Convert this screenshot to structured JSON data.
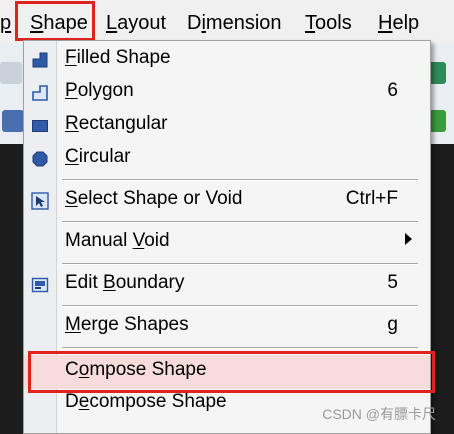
{
  "menubar": {
    "items": [
      {
        "pre": "",
        "mn": "p",
        "post": ""
      },
      {
        "pre": "",
        "mn": "S",
        "post": "hape"
      },
      {
        "pre": "",
        "mn": "L",
        "post": "ayout"
      },
      {
        "pre": "D",
        "mn": "i",
        "post": "mension"
      },
      {
        "pre": "",
        "mn": "T",
        "post": "ools"
      },
      {
        "pre": "",
        "mn": "H",
        "post": "elp"
      }
    ]
  },
  "dropdown": {
    "items": [
      {
        "pre": "",
        "mn": "F",
        "post": "illed Shape",
        "shortcut": "",
        "icon": "filled-shape-icon"
      },
      {
        "pre": "",
        "mn": "P",
        "post": "olygon",
        "shortcut": "6",
        "icon": "polygon-icon"
      },
      {
        "pre": "",
        "mn": "R",
        "post": "ectangular",
        "shortcut": "",
        "icon": "rectangle-icon"
      },
      {
        "pre": "",
        "mn": "C",
        "post": "ircular",
        "shortcut": "",
        "icon": "circle-icon"
      },
      {
        "pre": "",
        "mn": "S",
        "post": "elect Shape or Void",
        "shortcut": "Ctrl+F",
        "icon": "select-cursor-icon"
      },
      {
        "pre": "Manual ",
        "mn": "V",
        "post": "oid",
        "shortcut": "",
        "icon": ""
      },
      {
        "pre": "Edit ",
        "mn": "B",
        "post": "oundary",
        "shortcut": "5",
        "icon": "edit-boundary-icon"
      },
      {
        "pre": "",
        "mn": "M",
        "post": "erge Shapes",
        "shortcut": "g",
        "icon": ""
      },
      {
        "pre": "C",
        "mn": "o",
        "post": "mpose Shape",
        "shortcut": "",
        "icon": ""
      },
      {
        "pre": "D",
        "mn": "e",
        "post": "compose Shape",
        "shortcut": "",
        "icon": ""
      }
    ]
  },
  "watermark": "CSDN @有膘卡尺",
  "colors": {
    "highlight": "#e0231e",
    "icon_blue": "#2f5aa8"
  }
}
